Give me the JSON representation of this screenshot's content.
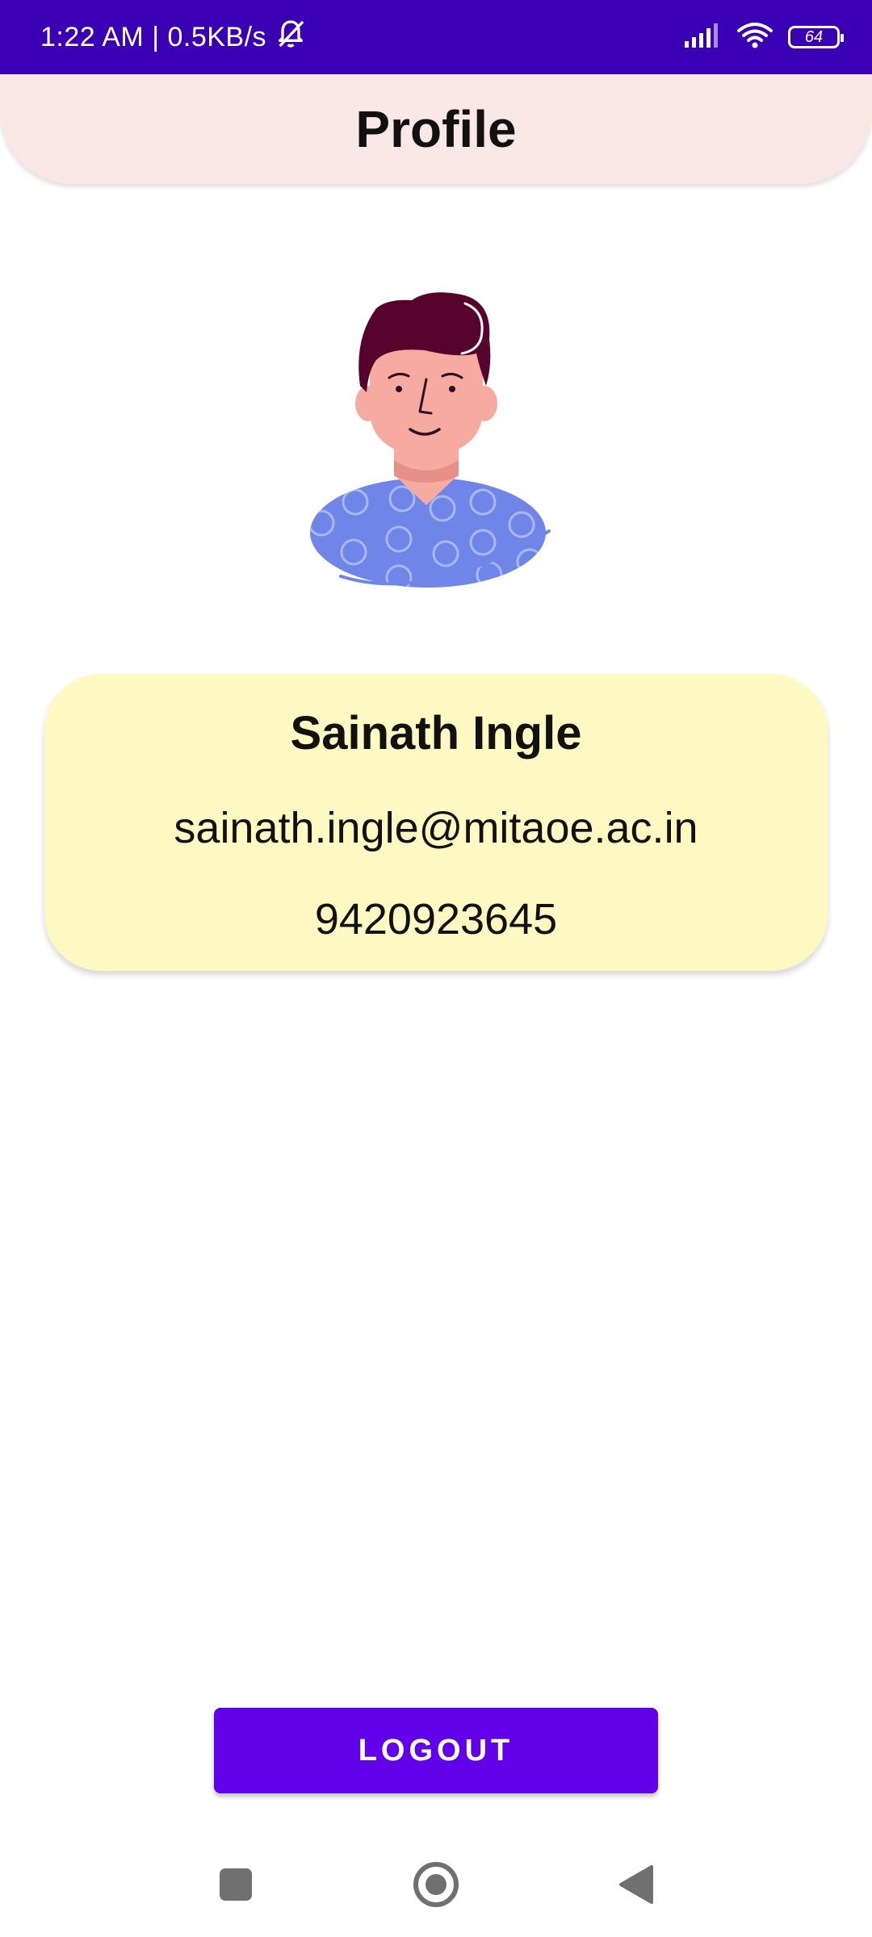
{
  "status_bar": {
    "time_speed": "1:22 AM | 0.5KB/s",
    "battery_level": "64",
    "icons": [
      "bell-off-icon",
      "signal-icon",
      "wifi-icon",
      "battery-icon"
    ]
  },
  "header": {
    "title": "Profile"
  },
  "avatar": {
    "icon": "user-avatar-illustration"
  },
  "profile": {
    "name": "Sainath Ingle",
    "email": "sainath.ingle@mitaoe.ac.in",
    "phone": "9420923645"
  },
  "actions": {
    "logout_label": "LOGOUT"
  },
  "navigation": {
    "icons": [
      "recents-square-icon",
      "home-circle-icon",
      "back-triangle-icon"
    ]
  },
  "colors": {
    "status_bar": "#3b00b3",
    "header_bg": "#f9e8e6",
    "card_bg": "#fef9c3",
    "button": "#6200ea",
    "shirt": "#6f86e8"
  }
}
